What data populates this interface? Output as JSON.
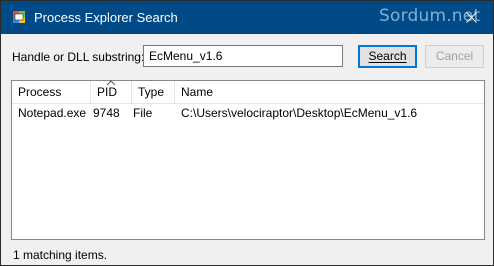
{
  "window": {
    "title": "Process Explorer Search",
    "watermark": "Sordum.net"
  },
  "search": {
    "label": "Handle or DLL substring:",
    "value": "EcMenu_v1.6",
    "search_button": "Search",
    "cancel_button": "Cancel"
  },
  "table": {
    "columns": [
      "Process",
      "PID",
      "Type",
      "Name"
    ],
    "sorted_column": "PID",
    "rows": [
      {
        "process": "Notepad.exe",
        "pid": "9748",
        "type": "File",
        "name": "C:\\Users\\velociraptor\\Desktop\\EcMenu_v1.6"
      }
    ]
  },
  "status": {
    "text": "1 matching items."
  },
  "colors": {
    "titlebar": "#004a87",
    "accent": "#0078d7",
    "window_bg": "#f0f0f0"
  }
}
